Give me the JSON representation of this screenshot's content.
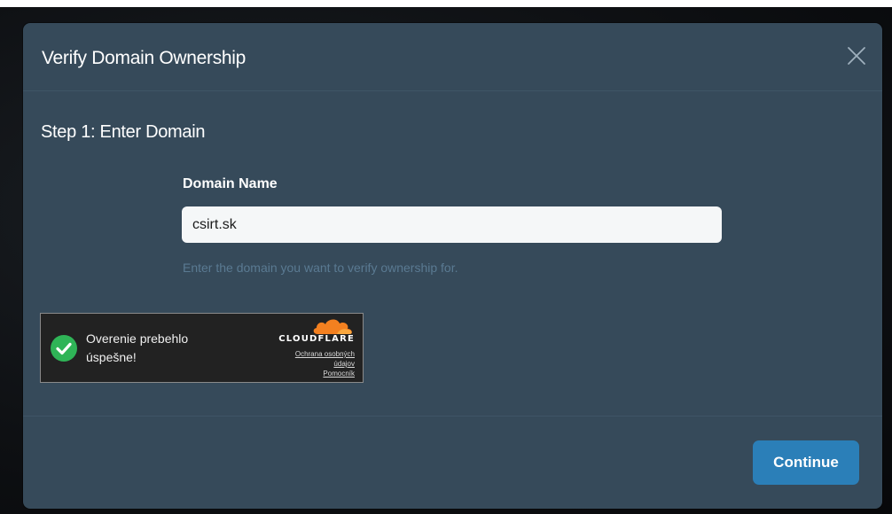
{
  "modal": {
    "title": "Verify Domain Ownership",
    "close_icon": "close-icon"
  },
  "step": {
    "title": "Step 1: Enter Domain"
  },
  "domain_field": {
    "label": "Domain Name",
    "value": "csirt.sk",
    "help_text": "Enter the domain you want to verify ownership for."
  },
  "captcha": {
    "status_text": "Overenie prebehlo úspešne!",
    "status_icon": "check-circle-icon",
    "brand": "CLOUDFLARE",
    "links": [
      "Ochrana osobných",
      "údajov",
      "Pomocník"
    ],
    "colors": {
      "success": "#2fb457",
      "cloud": "#f38020"
    }
  },
  "footer": {
    "continue_label": "Continue"
  },
  "colors": {
    "modal_bg": "#364a5a",
    "accent": "#2b7fb8",
    "help_text": "#5a7a92"
  }
}
